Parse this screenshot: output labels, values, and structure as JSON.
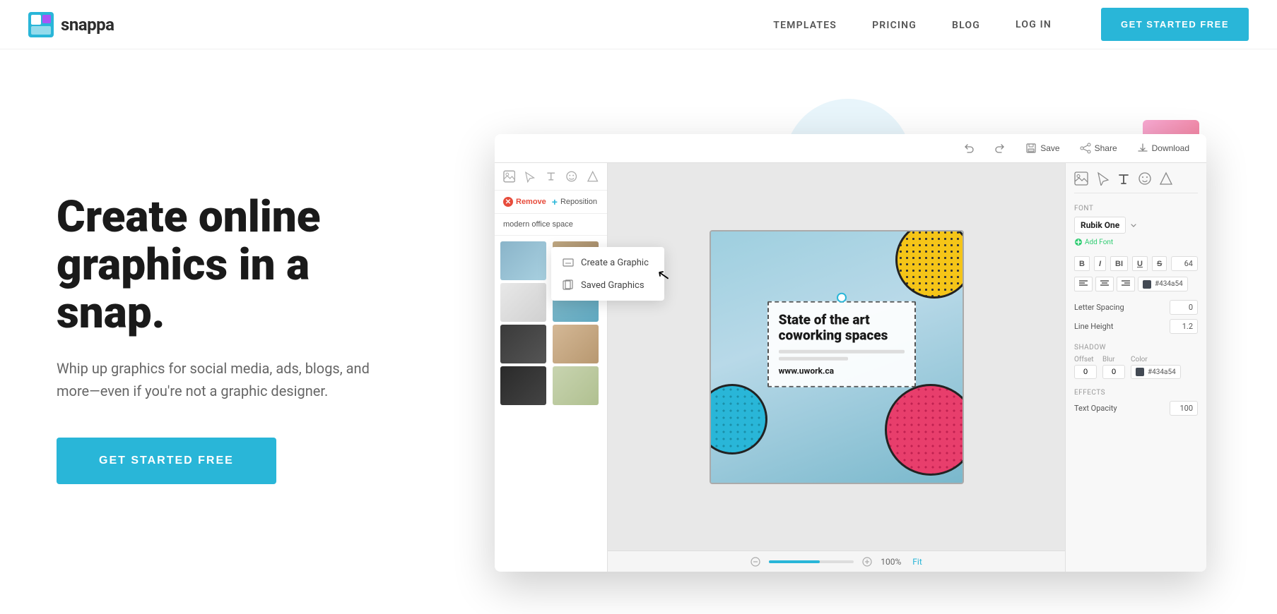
{
  "header": {
    "logo_text": "snappa",
    "nav": {
      "templates": "TEMPLATES",
      "pricing": "PRICING",
      "blog": "BLOG",
      "login": "LOG IN",
      "cta": "GET STARTED FREE"
    }
  },
  "hero": {
    "title": "Create online graphics in a snap.",
    "subtitle": "Whip up graphics for social media, ads, blogs, and more—even if you're not a graphic designer.",
    "cta_label": "GET STARTED FREE"
  },
  "editor": {
    "toolbar": {
      "undo_label": "",
      "redo_label": "",
      "save_label": "Save",
      "share_label": "Share",
      "download_label": "Download"
    },
    "dropdown": {
      "item1_label": "Create a Graphic",
      "item2_label": "Saved Graphics"
    },
    "image_search": {
      "placeholder": "modern office space",
      "remove_label": "Remove",
      "reposition_label": "Reposition"
    },
    "graphic": {
      "heading": "State of the art coworking spaces",
      "url": "www.uwork.ca"
    },
    "right_panel": {
      "font_label": "Font",
      "font_name": "Rubik One",
      "add_font_label": "Add Font",
      "bold_label": "B",
      "italic_label": "I",
      "bold_italic_label": "BI",
      "underline_label": "U",
      "strikethrough_label": "S",
      "font_size": "64",
      "letter_spacing_label": "Letter Spacing",
      "letter_spacing_value": "0",
      "line_height_label": "Line Height",
      "line_height_value": "1.2",
      "shadow_label": "Shadow",
      "shadow_offset_label": "Offset",
      "shadow_blur_label": "Blur",
      "shadow_color_label": "Color",
      "shadow_offset_value": "0",
      "shadow_blur_value": "0",
      "shadow_color_value": "#434a54",
      "effects_label": "Effects",
      "text_opacity_label": "Text Opacity",
      "text_opacity_value": "100",
      "color_value": "#434a54"
    },
    "zoom": {
      "value": "100%",
      "fit_label": "Fit"
    }
  }
}
